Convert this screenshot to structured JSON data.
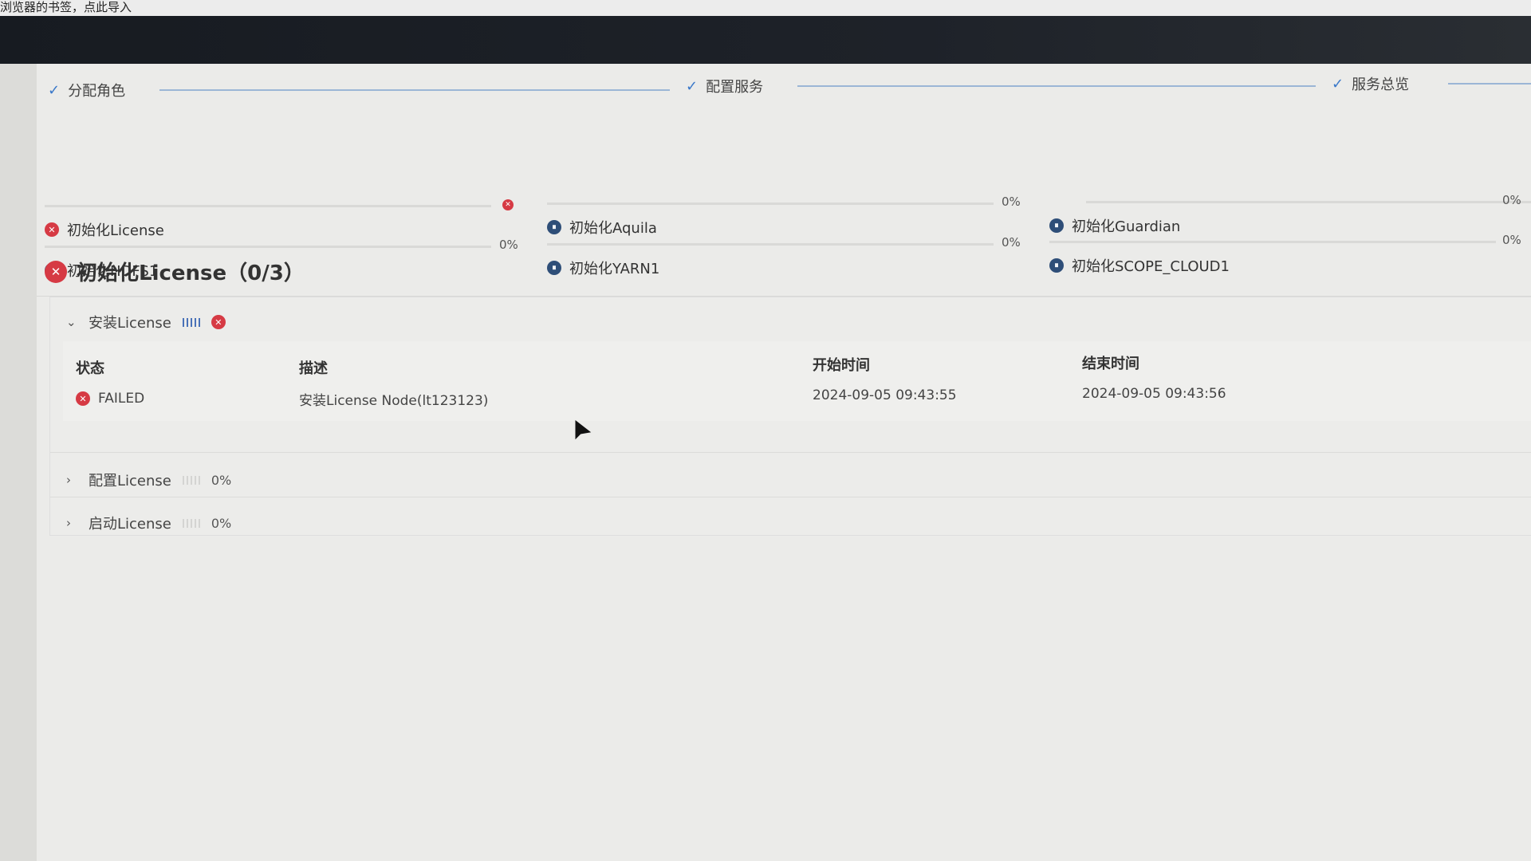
{
  "bookmark_bar": {
    "text": "浏览器的书签，点此导入"
  },
  "steps": [
    {
      "label": "分配角色"
    },
    {
      "label": "配置服务"
    },
    {
      "label": "服务总览"
    }
  ],
  "progress": {
    "items": [
      {
        "label": "初始化License",
        "status": "failed",
        "percent": ""
      },
      {
        "label": "初始化HDFS1",
        "status": "pending",
        "percent": "0%"
      },
      {
        "label": "初始化Aquila",
        "status": "pending",
        "percent": "0%"
      },
      {
        "label": "初始化YARN1",
        "status": "pending",
        "percent": "0%"
      },
      {
        "label": "初始化Guardian",
        "status": "pending",
        "percent": "0%"
      },
      {
        "label": "初始化SCOPE_CLOUD1",
        "status": "pending",
        "percent": "0%"
      }
    ]
  },
  "section": {
    "title": "初始化License（0/3）"
  },
  "tasks": {
    "install": {
      "label": "安装License"
    },
    "config": {
      "label": "配置License",
      "percent": "0%"
    },
    "start": {
      "label": "启动License",
      "percent": "0%"
    }
  },
  "table": {
    "headers": {
      "status": "状态",
      "desc": "描述",
      "start": "开始时间",
      "end": "结束时间"
    },
    "rows": [
      {
        "status": "FAILED",
        "desc": "安装License Node(lt123123)",
        "start": "2024-09-05 09:43:55",
        "end": "2024-09-05 09:43:56"
      }
    ]
  },
  "colors": {
    "failed": "#d63a44",
    "pending": "#2e4e78",
    "accent": "#3a78c9"
  }
}
